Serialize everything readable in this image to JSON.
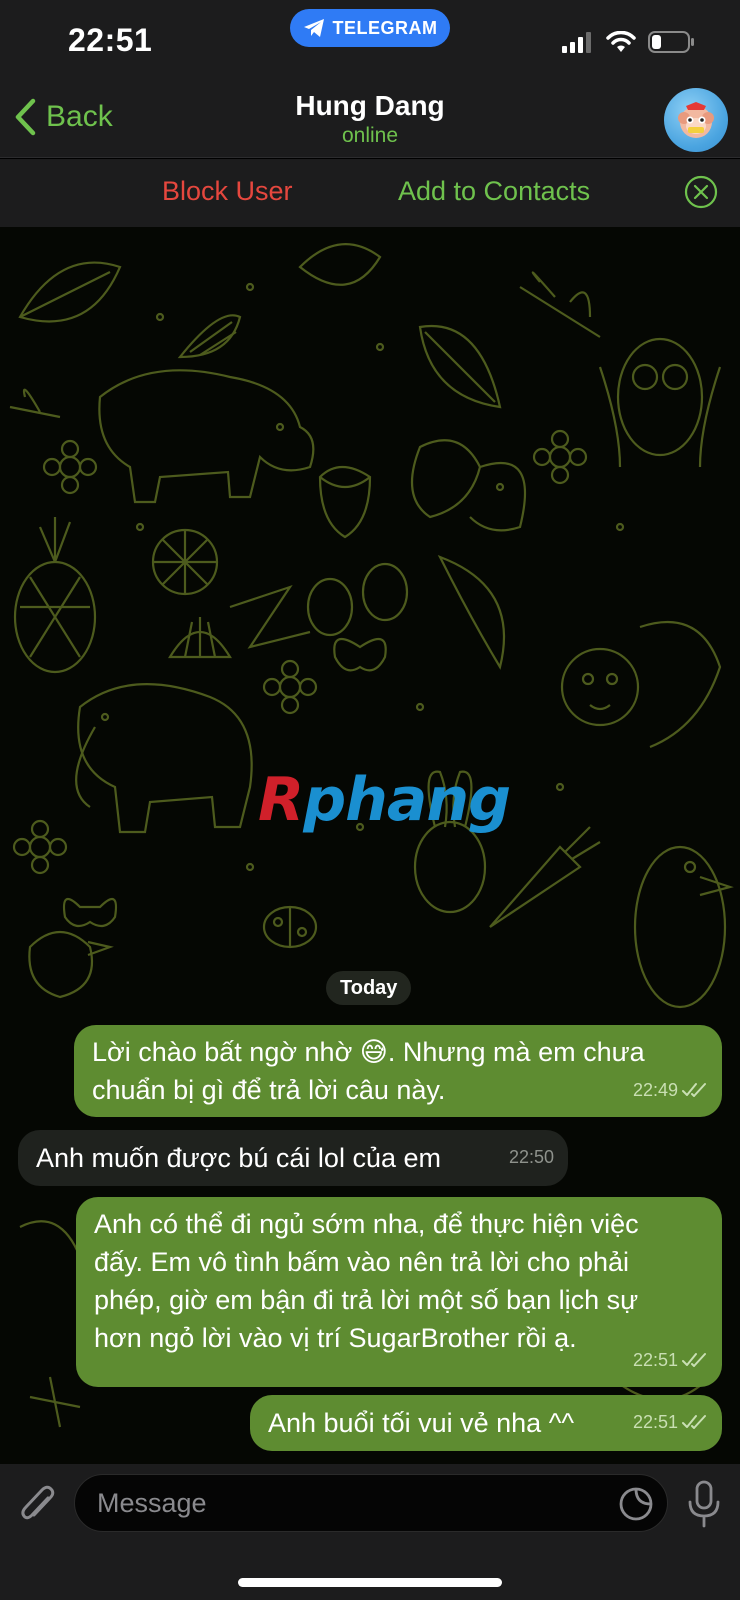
{
  "status_bar": {
    "time": "22:51",
    "pill_label": "TELEGRAM"
  },
  "header": {
    "back_label": "Back",
    "title": "Hung Dang",
    "subtitle": "online",
    "avatar_icon": "monkey-sticker-icon"
  },
  "action_bar": {
    "block_label": "Block User",
    "add_label": "Add to Contacts"
  },
  "watermark": {
    "first": "R",
    "rest": "phang"
  },
  "date_separator": "Today",
  "messages": [
    {
      "direction": "outgoing",
      "text": "Lời chào bất ngờ nhờ 😅. Nhưng mà em chưa\nchuẩn bị gì để trả lời câu này.",
      "time": "22:49",
      "status": "read"
    },
    {
      "direction": "incoming",
      "text": "Anh muốn được bú cái lol của em",
      "time": "22:50"
    },
    {
      "direction": "outgoing",
      "text": "Anh có thể đi ngủ sớm nha, để thực hiện việc\nđấy. Em vô tình bấm vào nên trả lời cho phải\nphép, giờ em bận đi trả lời một số bạn lịch sự\nhơn ngỏ lời vào vị trí SugarBrother rồi ạ.",
      "time": "22:51",
      "status": "read"
    },
    {
      "direction": "outgoing",
      "text": "Anh buổi tối vui vẻ nha ^^",
      "time": "22:51",
      "status": "read"
    }
  ],
  "composer": {
    "placeholder": "Message"
  },
  "colors": {
    "accent_green": "#6fc24d",
    "block_red": "#e5473e",
    "outgoing_bubble": "#5e8c31",
    "incoming_bubble": "#1f221e",
    "telegram_blue": "#2f7bf5"
  }
}
